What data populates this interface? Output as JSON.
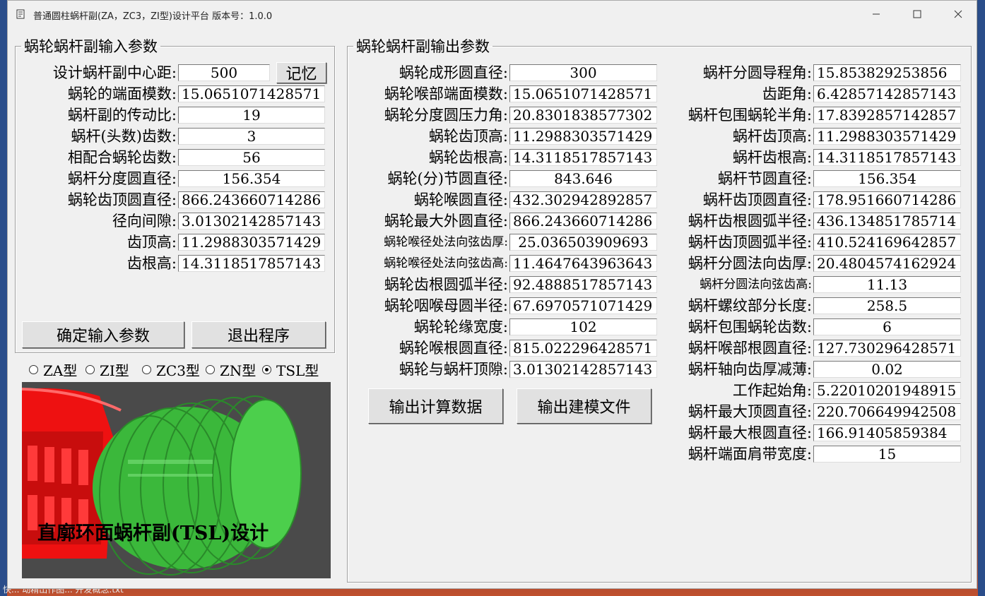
{
  "window": {
    "title": "普通圆柱蜗杆副(ZA，ZC3，ZI型)设计平台  版本号：1.0.0"
  },
  "input_group": {
    "legend": "蜗轮蜗杆副输入参数",
    "memory_button": "记忆",
    "fields": [
      {
        "label": "设计蜗杆副中心距:",
        "value": "500"
      },
      {
        "label": "蜗轮的端面模数:",
        "value": "15.0651071428571"
      },
      {
        "label": "蜗杆副的传动比:",
        "value": "19"
      },
      {
        "label": "蜗杆(头数)齿数:",
        "value": "3"
      },
      {
        "label": "相配合蜗轮齿数:",
        "value": "56"
      },
      {
        "label": "蜗杆分度圆直径:",
        "value": "156.354"
      },
      {
        "label": "蜗轮齿顶圆直径:",
        "value": "866.243660714286"
      },
      {
        "label": "径向间隙:",
        "value": "3.01302142857143"
      },
      {
        "label": "齿顶高:",
        "value": "11.2988303571429"
      },
      {
        "label": "齿根高:",
        "value": "14.3118517857143"
      }
    ],
    "confirm_button": "确定输入参数",
    "exit_button": "退出程序"
  },
  "types": [
    {
      "label": "ZA型",
      "selected": false
    },
    {
      "label": "ZI型",
      "selected": false
    },
    {
      "label": "ZC3型",
      "selected": false
    },
    {
      "label": "ZN型",
      "selected": false
    },
    {
      "label": "TSL型",
      "selected": true
    }
  ],
  "preview": {
    "caption": "直廓环面蜗杆副(TSL)设计"
  },
  "output_group": {
    "legend": "蜗轮蜗杆副输出参数",
    "left_fields": [
      {
        "label": "蜗轮成形圆直径:",
        "value": "300"
      },
      {
        "label": "蜗轮喉部端面模数:",
        "value": "15.0651071428571"
      },
      {
        "label": "蜗轮分度圆压力角:",
        "value": "20.8301838577302"
      },
      {
        "label": "蜗轮齿顶高:",
        "value": "11.2988303571429"
      },
      {
        "label": "蜗轮齿根高:",
        "value": "14.3118517857143"
      },
      {
        "label": "蜗轮(分)节圆直径:",
        "value": "843.646"
      },
      {
        "label": "蜗轮喉圆直径:",
        "value": "432.302942892857"
      },
      {
        "label": "蜗轮最大外圆直径:",
        "value": "866.243660714286"
      },
      {
        "label": "蜗轮喉径处法向弦齿厚:",
        "value": "25.036503909693"
      },
      {
        "label": "蜗轮喉径处法向弦齿高:",
        "value": "11.4647643963643"
      },
      {
        "label": "蜗轮齿根圆弧半径:",
        "value": "92.4888517857143"
      },
      {
        "label": "蜗轮咽喉母圆半径:",
        "value": "67.6970571071429"
      },
      {
        "label": "蜗轮轮缘宽度:",
        "value": "102"
      },
      {
        "label": "蜗轮喉根圆直径:",
        "value": "815.022296428571"
      },
      {
        "label": "蜗轮与蜗杆顶隙:",
        "value": "3.01302142857143"
      }
    ],
    "right_fields": [
      {
        "label": "蜗杆分圆导程角:",
        "value": "15.853829253856"
      },
      {
        "label": "齿距角:",
        "value": "6.42857142857143"
      },
      {
        "label": "蜗杆包围蜗轮半角:",
        "value": "17.8392857142857"
      },
      {
        "label": "蜗杆齿顶高:",
        "value": "11.2988303571429"
      },
      {
        "label": "蜗杆齿根高:",
        "value": "14.3118517857143"
      },
      {
        "label": "蜗杆节圆直径:",
        "value": "156.354"
      },
      {
        "label": "蜗杆齿顶圆直径:",
        "value": "178.951660714286"
      },
      {
        "label": "蜗杆齿根圆弧半径:",
        "value": "436.134851785714"
      },
      {
        "label": "蜗杆齿顶圆弧半径:",
        "value": "410.524169642857"
      },
      {
        "label": "蜗杆分圆法向齿厚:",
        "value": "20.4804574162924"
      },
      {
        "label": "蜗杆分圆法向弦齿高:",
        "value": "11.13"
      },
      {
        "label": "蜗杆螺纹部分长度:",
        "value": "258.5"
      },
      {
        "label": "蜗杆包围蜗轮齿数:",
        "value": "6"
      },
      {
        "label": "蜗杆喉部根圆直径:",
        "value": "127.730296428571"
      },
      {
        "label": "蜗杆轴向齿厚减薄:",
        "value": "0.02"
      },
      {
        "label": "工作起始角:",
        "value": "5.22010201948915"
      },
      {
        "label": "蜗杆最大顶圆直径:",
        "value": "220.706649942508"
      },
      {
        "label": "蜗杆最大根圆直径:",
        "value": "166.91405859384"
      },
      {
        "label": "蜗杆端面肩带宽度:",
        "value": "15"
      }
    ],
    "calc_button": "输出计算数据",
    "model_button": "输出建模文件"
  },
  "desktop": {
    "taskbar_text": "快... 动精出作图... 开发概念.txt"
  },
  "colors": {
    "wheel": "#ee1111",
    "worm": "#3bb83b",
    "preview_bg": "#4a4a4a"
  }
}
